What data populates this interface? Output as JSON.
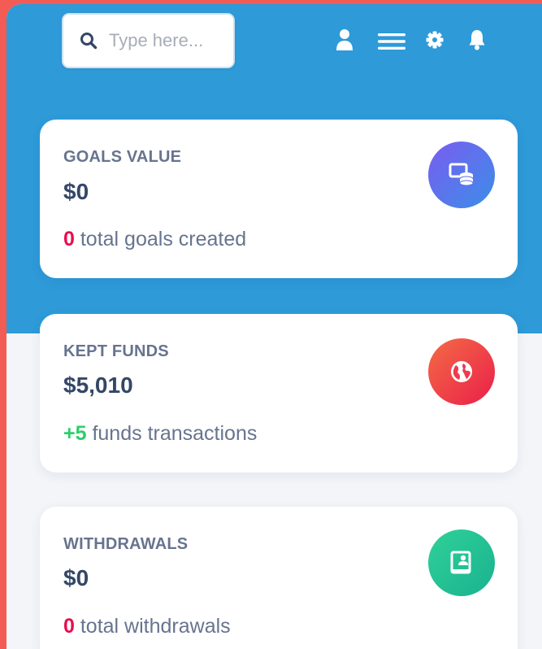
{
  "search": {
    "placeholder": "Type here..."
  },
  "topbar": {
    "icons": [
      "user-icon",
      "menu-icon",
      "gear-icon",
      "bell-icon"
    ]
  },
  "cards": [
    {
      "title": "GOALS VALUE",
      "value": "$0",
      "foot_number": "0",
      "foot_text": " total goals created",
      "icon": "goals-icon",
      "colors": [
        "#7a5cf0",
        "#3b8ee8"
      ]
    },
    {
      "title": "KEPT FUNDS",
      "value": "$5,010",
      "foot_number": "+5",
      "foot_text": " funds transactions",
      "icon": "globe-icon",
      "colors": [
        "#f2594a",
        "#ea1f4a"
      ]
    },
    {
      "title": "WITHDRAWALS",
      "value": "$0",
      "foot_number": "0",
      "foot_text": " total withdrawals",
      "icon": "withdraw-icon",
      "colors": [
        "#2fd199",
        "#1ab28f"
      ]
    }
  ],
  "colors": {
    "background": "#f25c54",
    "header": "#2e9ad8",
    "negative": "#ea0b50",
    "positive": "#2dce6b"
  }
}
